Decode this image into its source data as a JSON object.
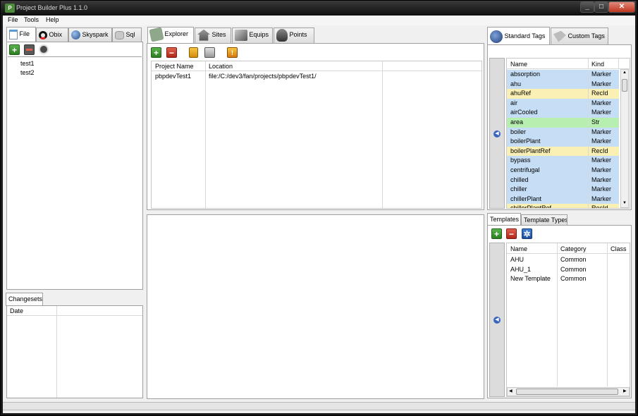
{
  "window": {
    "title": "Project Builder Plus 1.1.0"
  },
  "menu": [
    "File",
    "Tools",
    "Help"
  ],
  "left_tabs": [
    "File",
    "Obix",
    "Skyspark",
    "Sql"
  ],
  "tree_items": [
    "test1",
    "test2"
  ],
  "changesets": {
    "tab": "Changesets",
    "col_date": "Date"
  },
  "center_tabs": [
    "Explorer",
    "Sites",
    "Equips",
    "Points"
  ],
  "projects": {
    "columns": [
      "Project Name",
      "Location"
    ],
    "rows": [
      {
        "name": "pbpdevTest1",
        "location": "file:/C:/dev3/fan/projects/pbpdevTest1/"
      }
    ]
  },
  "tag_tabs": [
    "Standard Tags",
    "Custom Tags"
  ],
  "tags": {
    "columns": [
      "Name",
      "Kind"
    ],
    "rows": [
      {
        "name": "absorption",
        "kind": "Marker",
        "color": "#c5ddf5"
      },
      {
        "name": "ahu",
        "kind": "Marker",
        "color": "#c5ddf5"
      },
      {
        "name": "ahuRef",
        "kind": "RecId",
        "color": "#fbf0b4"
      },
      {
        "name": "air",
        "kind": "Marker",
        "color": "#c5ddf5"
      },
      {
        "name": "airCooled",
        "kind": "Marker",
        "color": "#c5ddf5"
      },
      {
        "name": "area",
        "kind": "Str",
        "color": "#b7efb0"
      },
      {
        "name": "boiler",
        "kind": "Marker",
        "color": "#c5ddf5"
      },
      {
        "name": "boilerPlant",
        "kind": "Marker",
        "color": "#c5ddf5"
      },
      {
        "name": "boilerPlantRef",
        "kind": "RecId",
        "color": "#fbf0b4"
      },
      {
        "name": "bypass",
        "kind": "Marker",
        "color": "#c5ddf5"
      },
      {
        "name": "centrifugal",
        "kind": "Marker",
        "color": "#c5ddf5"
      },
      {
        "name": "chilled",
        "kind": "Marker",
        "color": "#c5ddf5"
      },
      {
        "name": "chiller",
        "kind": "Marker",
        "color": "#c5ddf5"
      },
      {
        "name": "chillerPlant",
        "kind": "Marker",
        "color": "#c5ddf5"
      },
      {
        "name": "chillerPlantRef",
        "kind": "RecId",
        "color": "#fbf0b4"
      }
    ]
  },
  "template_tabs": [
    "Templates",
    "Template Types"
  ],
  "templates": {
    "columns": [
      "Name",
      "Category",
      "Class"
    ],
    "rows": [
      {
        "name": "AHU",
        "category": "Common"
      },
      {
        "name": "AHU_1",
        "category": "Common"
      },
      {
        "name": "New Template",
        "category": "Common"
      }
    ]
  }
}
